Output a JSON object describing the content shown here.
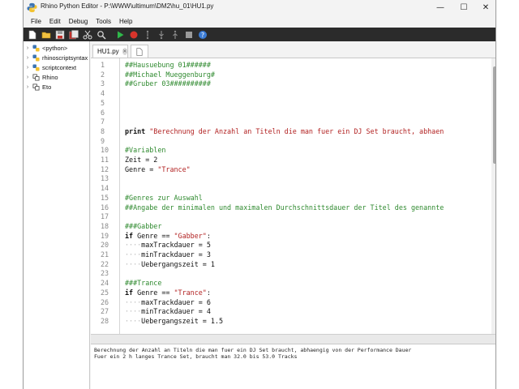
{
  "window": {
    "title": "Rhino Python Editor - P:\\WWW\\ultimum\\DM2\\hu_01\\HU1.py",
    "controls": {
      "minimize": "—",
      "maximize": "☐",
      "close": "✕"
    }
  },
  "menu": [
    "File",
    "Edit",
    "Debug",
    "Tools",
    "Help"
  ],
  "toolbar": [
    "new-file-icon",
    "open-folder-icon",
    "save-icon",
    "save-all-icon",
    "cut-icon",
    "find-icon",
    "run-icon",
    "stop-icon",
    "step-over-icon",
    "step-into-icon",
    "step-out-icon",
    "breakpoint-icon",
    "help-icon"
  ],
  "sidebar": {
    "items": [
      {
        "label": "<python>",
        "icon": "python-icon"
      },
      {
        "label": "rhinoscriptsyntax",
        "icon": "python-icon"
      },
      {
        "label": "scriptcontext",
        "icon": "python-icon"
      },
      {
        "label": "Rhino",
        "icon": "namespace-icon"
      },
      {
        "label": "Eto",
        "icon": "namespace-icon"
      }
    ]
  },
  "tabs": {
    "file": "HU1.py",
    "close": "✕"
  },
  "code_lines": [
    {
      "n": "1",
      "text": "##Hausuebung 01######"
    },
    {
      "n": "2",
      "text": "##Michael Mueggenburg#"
    },
    {
      "n": "3",
      "text": "##Gruber 03##########"
    },
    {
      "n": "4",
      "text": ""
    },
    {
      "n": "5",
      "text": ""
    },
    {
      "n": "6",
      "text": ""
    },
    {
      "n": "7",
      "text": ""
    },
    {
      "n": "8",
      "kw": "print",
      "str": " \"Berechnung der Anzahl an Titeln die man fuer ein DJ Set braucht, abhaen"
    },
    {
      "n": "9",
      "text": ""
    },
    {
      "n": "10",
      "text": "#Variablen"
    },
    {
      "n": "11",
      "plain": "Zeit = 2"
    },
    {
      "n": "12",
      "plain": "Genre = ",
      "str": "\"Trance\""
    },
    {
      "n": "13",
      "text": ""
    },
    {
      "n": "14",
      "text": ""
    },
    {
      "n": "15",
      "text": "#Genres zur Auswahl"
    },
    {
      "n": "16",
      "text": "##Angabe der minimalen und maximalen Durchschnittsdauer der Titel des genannte"
    },
    {
      "n": "17",
      "text": ""
    },
    {
      "n": "18",
      "text": "###Gabber"
    },
    {
      "n": "19",
      "kw": "if",
      "plain": " Genre == ",
      "str": "\"Gabber\"",
      "tail": ":"
    },
    {
      "n": "20",
      "dots": "····",
      "plain": "maxTrackdauer = 5"
    },
    {
      "n": "21",
      "dots": "····",
      "plain": "minTrackdauer = 3"
    },
    {
      "n": "22",
      "dots": "····",
      "plain": "Uebergangszeit = 1"
    },
    {
      "n": "23",
      "text": ""
    },
    {
      "n": "24",
      "text": "###Trance"
    },
    {
      "n": "25",
      "kw": "if",
      "plain": " Genre == ",
      "str": "\"Trance\"",
      "tail": ":"
    },
    {
      "n": "26",
      "dots": "····",
      "plain": "maxTrackdauer = 6"
    },
    {
      "n": "27",
      "dots": "····",
      "plain": "minTrackdauer = 4"
    },
    {
      "n": "28",
      "dots": "····",
      "plain": "Uebergangszeit = 1.5"
    }
  ],
  "output": {
    "lines": [
      "Berechnung der Anzahl an Titeln die man fuer ein DJ Set braucht, abhaengig von der Performance Dauer",
      "Fuer ein 2 h langes  Trance Set, braucht man 32.0 bis 53.0 Tracks"
    ]
  },
  "colors": {
    "comment": "#2f8a2f",
    "string": "#b22222",
    "toolbar_bg": "#2b2b2b"
  }
}
